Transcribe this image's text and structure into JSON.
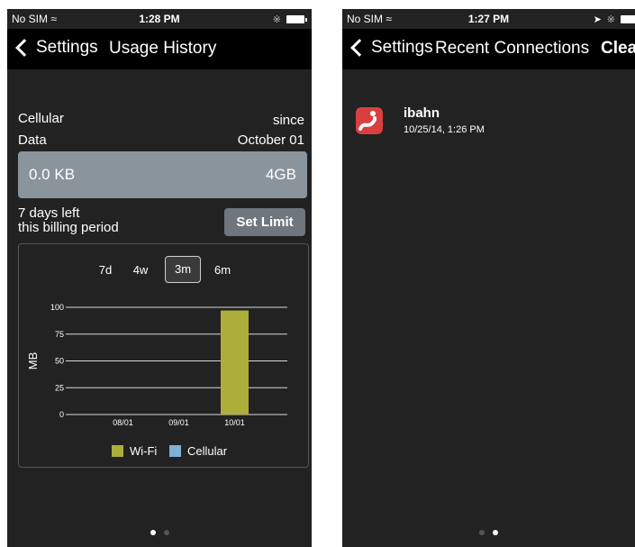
{
  "left_screen": {
    "status": {
      "carrier": "No SIM",
      "time": "1:28 PM"
    },
    "nav": {
      "back_label": "Settings",
      "title": "Usage History"
    },
    "cellular_label": "Cellular",
    "data_label": "Data",
    "since_label": "since",
    "since_date": "October 01",
    "usage": {
      "used": "0.0 KB",
      "limit": "4GB"
    },
    "days_left": "7 days left",
    "billing_period": "this billing period",
    "set_limit_label": "Set Limit",
    "chart_data": {
      "type": "bar",
      "categories": [
        "08/01",
        "09/01",
        "10/01"
      ],
      "ylabel": "MB",
      "ylim": [
        0,
        100
      ],
      "yticks": [
        0,
        25,
        50,
        75,
        100
      ],
      "series": [
        {
          "name": "Wi-Fi",
          "color": "#adad3a",
          "values": [
            0,
            0,
            97
          ]
        },
        {
          "name": "Cellular",
          "color": "#7fb0d6",
          "values": [
            0,
            0,
            0
          ]
        }
      ],
      "range_tabs": [
        "7d",
        "4w",
        "3m",
        "6m"
      ],
      "selected_range": "3m",
      "grid": true,
      "legend": "bottom"
    },
    "page_indicator": {
      "count": 2,
      "active": 0
    }
  },
  "right_screen": {
    "status": {
      "carrier": "No SIM",
      "time": "1:27 PM"
    },
    "nav": {
      "back_label": "Settings",
      "title": "Recent Connections",
      "action_label": "Clear"
    },
    "connections": [
      {
        "name": "ibahn",
        "time": "10/25/14, 1:26 PM",
        "icon": "ibahn-app-icon"
      }
    ],
    "page_indicator": {
      "count": 2,
      "active": 1
    }
  }
}
